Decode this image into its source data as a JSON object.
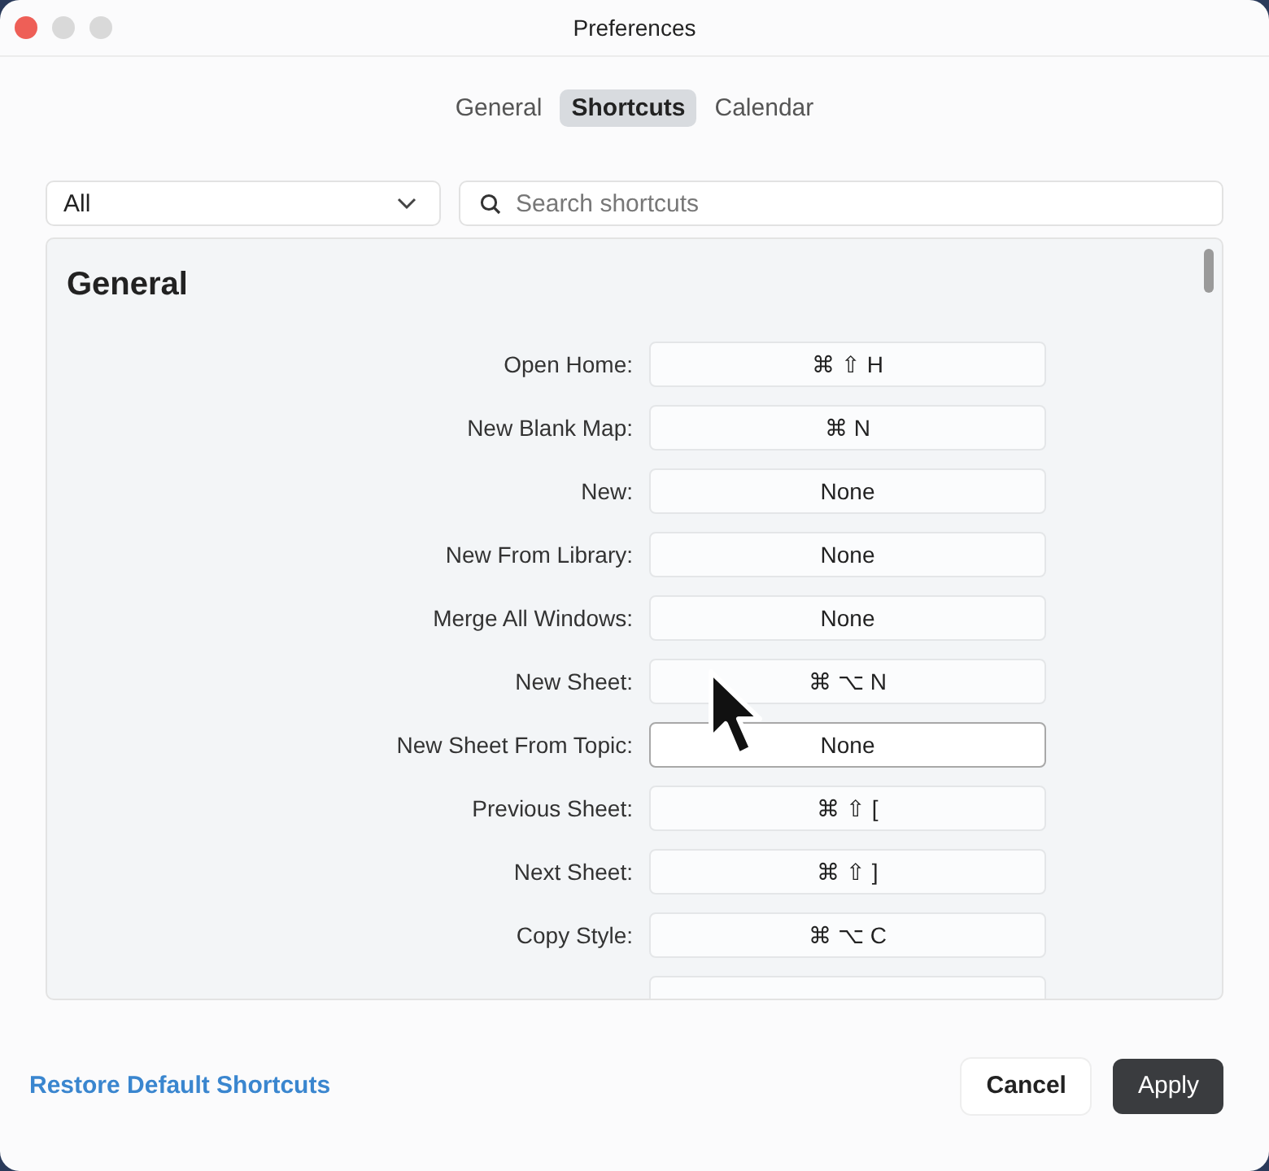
{
  "window": {
    "title": "Preferences"
  },
  "tabs": [
    {
      "label": "General",
      "selected": false
    },
    {
      "label": "Shortcuts",
      "selected": true
    },
    {
      "label": "Calendar",
      "selected": false
    }
  ],
  "filter": {
    "value": "All"
  },
  "search": {
    "placeholder": "Search shortcuts"
  },
  "section": {
    "title": "General"
  },
  "shortcuts": [
    {
      "name": "Open Home:",
      "keys": "⌘ ⇧ H",
      "selected": false
    },
    {
      "name": "New Blank Map:",
      "keys": "⌘ N",
      "selected": false
    },
    {
      "name": "New:",
      "keys": "None",
      "selected": false
    },
    {
      "name": "New From Library:",
      "keys": "None",
      "selected": false
    },
    {
      "name": "Merge All Windows:",
      "keys": "None",
      "selected": false
    },
    {
      "name": "New Sheet:",
      "keys": "⌘ ⌥ N",
      "selected": false
    },
    {
      "name": "New Sheet From Topic:",
      "keys": "None",
      "selected": true
    },
    {
      "name": "Previous Sheet:",
      "keys": "⌘ ⇧ [",
      "selected": false
    },
    {
      "name": "Next Sheet:",
      "keys": "⌘ ⇧ ]",
      "selected": false
    },
    {
      "name": "Copy Style:",
      "keys": "⌘ ⌥ C",
      "selected": false
    }
  ],
  "footer": {
    "link": "Restore Default Shortcuts",
    "buttons": [
      {
        "label": "Cancel",
        "kind": "secondary"
      },
      {
        "label": "Apply",
        "kind": "primary"
      }
    ]
  }
}
